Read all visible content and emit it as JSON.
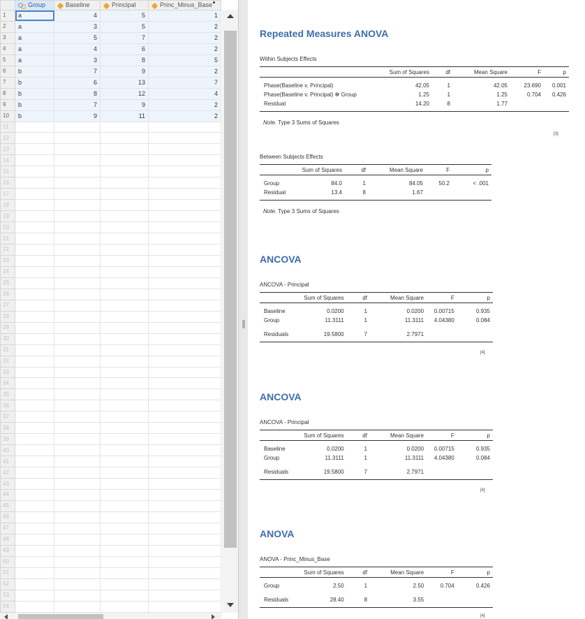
{
  "sheet": {
    "columns": [
      {
        "name": "Group",
        "type": "nominal"
      },
      {
        "name": "Baseline",
        "type": "continuous"
      },
      {
        "name": "Principal",
        "type": "continuous"
      },
      {
        "name": "Princ_Minus_Base",
        "type": "continuous",
        "computed": true
      }
    ],
    "rows": [
      [
        "a",
        "4",
        "5",
        "1"
      ],
      [
        "a",
        "3",
        "5",
        "2"
      ],
      [
        "a",
        "5",
        "7",
        "2"
      ],
      [
        "a",
        "4",
        "6",
        "2"
      ],
      [
        "a",
        "3",
        "8",
        "5"
      ],
      [
        "b",
        "7",
        "9",
        "2"
      ],
      [
        "b",
        "6",
        "13",
        "7"
      ],
      [
        "b",
        "8",
        "12",
        "4"
      ],
      [
        "b",
        "7",
        "9",
        "2"
      ],
      [
        "b",
        "9",
        "11",
        "2"
      ]
    ],
    "total_row_numbers": 54
  },
  "results": {
    "rm_anova": {
      "title": "Repeated Measures ANOVA",
      "within": {
        "caption": "Within Subjects Effects",
        "headers": [
          "",
          "Sum of Squares",
          "df",
          "Mean Square",
          "F",
          "p"
        ],
        "rows": [
          [
            "Phase(Baseline v. Principal)",
            "42.05",
            "1",
            "42.05",
            "23.690",
            "0.001"
          ],
          [
            "Phase(Baseline v. Principal) ✻ Group",
            "1.25",
            "1",
            "1.25",
            "0.704",
            "0.426"
          ],
          [
            "Residual",
            "14.20",
            "8",
            "1.77",
            "",
            ""
          ]
        ],
        "note_label": "Note.",
        "note_text": " Type 3 Sums of Squares",
        "ref": "[3]"
      },
      "between": {
        "caption": "Between Subjects Effects",
        "headers": [
          "",
          "Sum of Squares",
          "df",
          "Mean Square",
          "F",
          "p"
        ],
        "rows": [
          [
            "Group",
            "84.0",
            "1",
            "84.05",
            "50.2",
            "< .001"
          ],
          [
            "Residual",
            "13.4",
            "8",
            "1.67",
            "",
            ""
          ]
        ],
        "note_label": "Note.",
        "note_text": " Type 3 Sums of Squares"
      }
    },
    "ancova1": {
      "title": "ANCOVA",
      "caption": "ANCOVA - Principal",
      "headers": [
        "",
        "Sum of Squares",
        "df",
        "Mean Square",
        "F",
        "p"
      ],
      "rows": [
        [
          "Baseline",
          "0.0200",
          "1",
          "0.0200",
          "0.00715",
          "0.935"
        ],
        [
          "Group",
          "11.3111",
          "1",
          "11.3111",
          "4.04380",
          "0.084"
        ],
        [
          "Residuals",
          "19.5800",
          "7",
          "2.7971",
          "",
          ""
        ]
      ],
      "ref": "[4]"
    },
    "ancova2": {
      "title": "ANCOVA",
      "caption": "ANCOVA - Principal",
      "headers": [
        "",
        "Sum of Squares",
        "df",
        "Mean Square",
        "F",
        "p"
      ],
      "rows": [
        [
          "Baseline",
          "0.0200",
          "1",
          "0.0200",
          "0.00715",
          "0.935"
        ],
        [
          "Group",
          "11.3111",
          "1",
          "11.3111",
          "4.04380",
          "0.084"
        ],
        [
          "Residuals",
          "19.5800",
          "7",
          "2.7971",
          "",
          ""
        ]
      ],
      "ref": "[4]"
    },
    "anova": {
      "title": "ANOVA",
      "caption": "ANOVA - Princ_Minus_Base",
      "headers": [
        "",
        "Sum of Squares",
        "df",
        "Mean Square",
        "F",
        "p"
      ],
      "rows": [
        [
          "Group",
          "2.50",
          "1",
          "2.50",
          "0.704",
          "0.426"
        ],
        [
          "Residuals",
          "28.40",
          "8",
          "3.55",
          "",
          ""
        ]
      ],
      "ref": "[4]"
    }
  },
  "colors": {
    "accent": "#3e6ea9",
    "selection": "#4a86d0",
    "cell_fill": "#eef4fb",
    "ruler_icon": "#e9a838"
  }
}
